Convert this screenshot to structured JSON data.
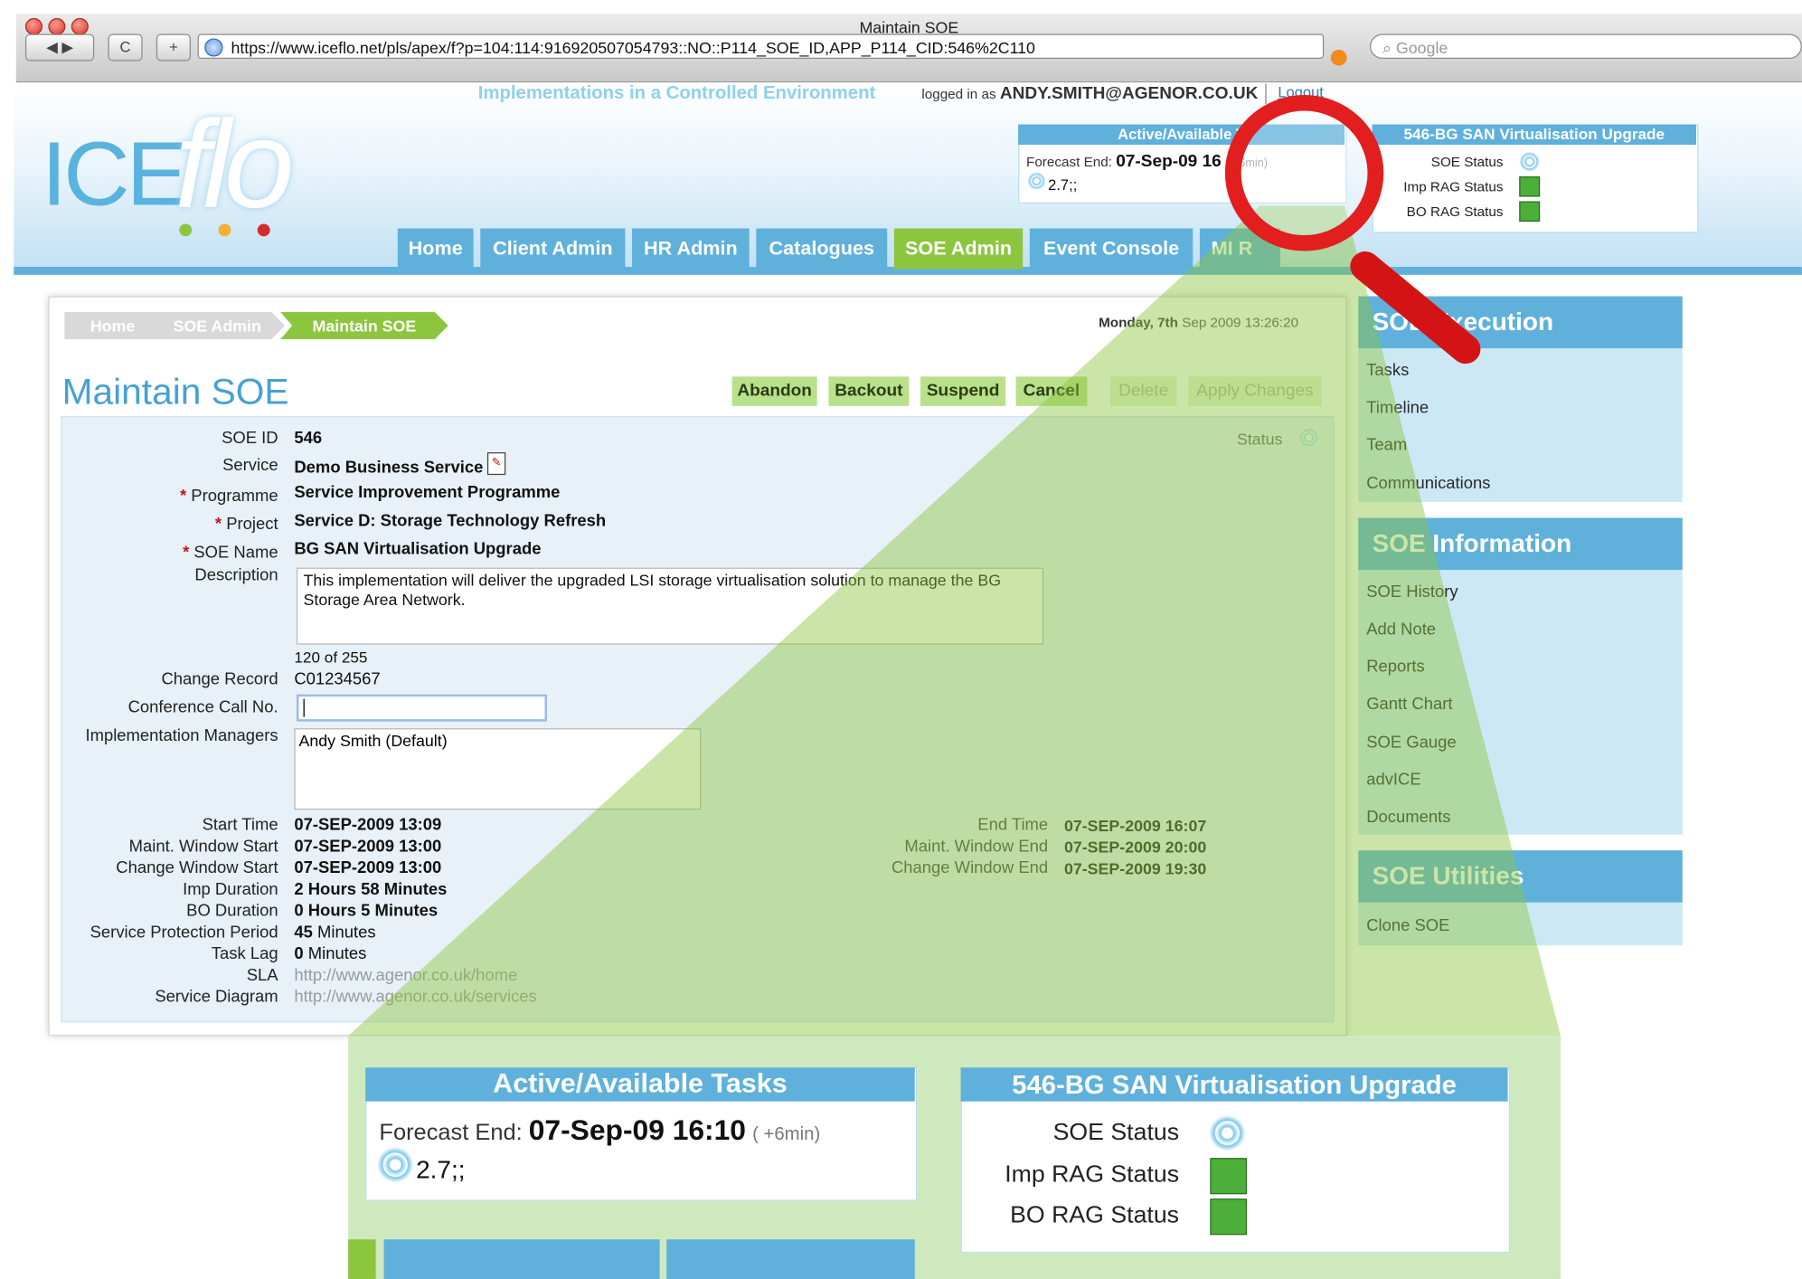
{
  "window": {
    "title": "Maintain SOE",
    "url": "https://www.iceflo.net/pls/apex/f?p=104:114:916920507054793::NO::P114_SOE_ID,APP_P114_CID:546%2C110",
    "search_placeholder": "Google",
    "back_glyph": "◀ ▶",
    "reload_glyph": "C",
    "add_glyph": "+"
  },
  "header": {
    "logo_ice": "ICE",
    "logo_flo": "flo",
    "tagline": "Implementations in a Controlled Environment",
    "logged_in_prefix": "logged in as",
    "user": "ANDY.SMITH@AGENOR.CO.UK",
    "logout": "Logout",
    "tabs": [
      "Home",
      "Client Admin",
      "HR Admin",
      "Catalogues",
      "SOE Admin",
      "Event Console",
      "MI R"
    ],
    "active_tab": "SOE Admin"
  },
  "tasks_widget": {
    "title": "Active/Available T",
    "forecast_label": "Forecast End:",
    "forecast_value": "07-Sep-09 16",
    "delta": "( +6min)",
    "value": "2.7;;"
  },
  "status_widget": {
    "title": "546-BG SAN Virtualisation Upgrade",
    "rows": [
      "SOE Status",
      "Imp RAG Status",
      "BO RAG Status"
    ]
  },
  "breadcrumb": [
    "Home",
    "SOE Admin",
    "Maintain SOE"
  ],
  "datetime": {
    "day": "Monday, 7th",
    "rest": "Sep 2009 13:26:20"
  },
  "page_title": "Maintain SOE",
  "buttons": [
    "Abandon",
    "Backout",
    "Suspend",
    "Cancel",
    "Delete",
    "Apply Changes"
  ],
  "status_label": "Status",
  "form": {
    "soe_id": {
      "label": "SOE ID",
      "value": "546"
    },
    "service": {
      "label": "Service",
      "value": "Demo Business Service"
    },
    "programme": {
      "label": "Programme",
      "value": "Service Improvement Programme"
    },
    "project": {
      "label": "Project",
      "value": "Service D: Storage Technology Refresh"
    },
    "soe_name": {
      "label": "SOE Name",
      "value": "BG SAN Virtualisation Upgrade"
    },
    "description": {
      "label": "Description",
      "value": "This implementation will deliver the upgraded LSI storage virtualisation solution to manage the BG Storage Area Network."
    },
    "char_count": "120  of  255",
    "change_record": {
      "label": "Change Record",
      "value": "C01234567"
    },
    "conference_call": {
      "label": "Conference Call No.",
      "value": ""
    },
    "impl_managers": {
      "label": "Implementation Managers",
      "value": "Andy Smith (Default)"
    },
    "start_time": {
      "label": "Start Time",
      "value": "07-SEP-2009 13:09"
    },
    "maint_start": {
      "label": "Maint. Window Start",
      "value": "07-SEP-2009 13:00"
    },
    "change_start": {
      "label": "Change Window Start",
      "value": "07-SEP-2009 13:00"
    },
    "imp_duration": {
      "label": "Imp Duration",
      "value": "2 Hours 58 Minutes"
    },
    "bo_duration": {
      "label": "BO Duration",
      "value": "0 Hours 5 Minutes"
    },
    "protection": {
      "label": "Service Protection Period",
      "value_num": "45",
      "value_unit": "Minutes"
    },
    "task_lag": {
      "label": "Task Lag",
      "value_num": "0",
      "value_unit": "Minutes"
    },
    "sla": {
      "label": "SLA",
      "value": "http://www.agenor.co.uk/home"
    },
    "diagram": {
      "label": "Service Diagram",
      "value": "http://www.agenor.co.uk/services"
    },
    "end_time": {
      "label": "End Time",
      "value": "07-SEP-2009 16:07"
    },
    "maint_end": {
      "label": "Maint. Window End",
      "value": "07-SEP-2009 20:00"
    },
    "change_end": {
      "label": "Change Window End",
      "value": "07-SEP-2009 19:30"
    }
  },
  "sidebar": {
    "execution": {
      "title": "SOE Execution",
      "items": [
        "Tasks",
        "Timeline",
        "Team",
        "Communications"
      ]
    },
    "information": {
      "title": "SOE Information",
      "items": [
        "SOE History",
        "Add Note",
        "Reports",
        "Gantt Chart",
        "SOE Gauge",
        "advICE",
        "Documents"
      ]
    },
    "utilities": {
      "title": "SOE Utilities",
      "items": [
        "Clone SOE"
      ]
    }
  },
  "zoom": {
    "tasks_title": "Active/Available Tasks",
    "forecast_label": "Forecast End:",
    "forecast_value": "07-Sep-09 16:10",
    "delta": "( +6min)",
    "value": "2.7;;",
    "status_title": "546-BG SAN Virtualisation Upgrade",
    "rows": [
      "SOE Status",
      "Imp RAG Status",
      "BO RAG Status"
    ]
  },
  "colors": {
    "brand_blue": "#5fb1dc",
    "active_green": "#8cc63f",
    "required_red": "#c2121f",
    "magnifier_red": "#e21e1e"
  }
}
